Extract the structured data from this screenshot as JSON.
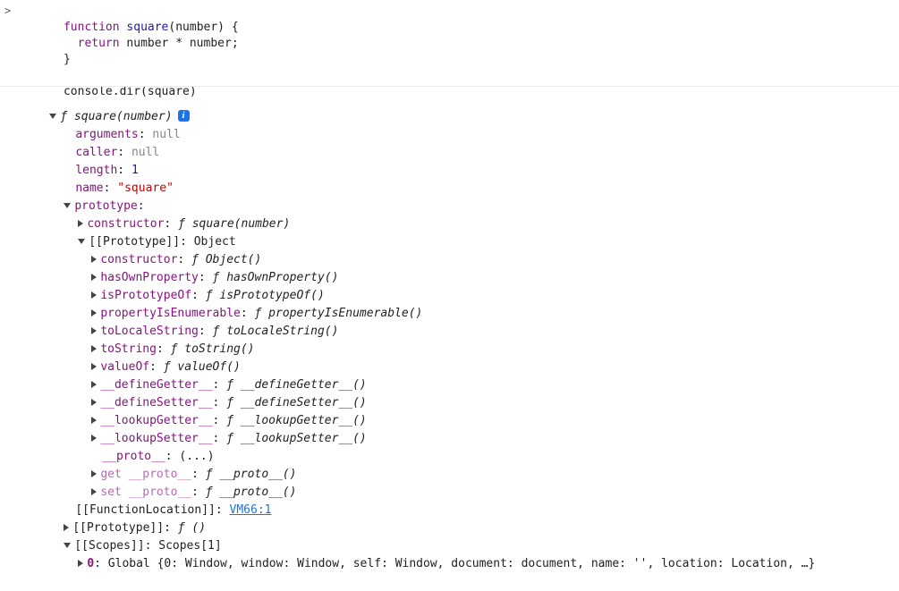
{
  "input": {
    "prompt_symbol": ">",
    "code_lines": [
      {
        "kw": "function",
        "name": " square",
        "rest": "(number) {"
      },
      {
        "kw": "  return",
        "name": "",
        "rest": " number * number;"
      },
      {
        "kw": "",
        "name": "",
        "rest": "}"
      },
      {
        "kw": "",
        "name": "",
        "rest": ""
      },
      {
        "kw": "",
        "name": "",
        "rest": "console.dir(square)"
      }
    ]
  },
  "output": {
    "root": {
      "prefix": "ƒ",
      "text": "square(number)",
      "info_icon": "i"
    },
    "rows": [
      {
        "key": "arguments",
        "value": "null",
        "vtype": "null"
      },
      {
        "key": "caller",
        "value": "null",
        "vtype": "null"
      },
      {
        "key": "length",
        "value": "1",
        "vtype": "num"
      },
      {
        "key": "name",
        "value": "\"square\"",
        "vtype": "str"
      },
      {
        "key": "prototype",
        "value": ""
      },
      {
        "key": "constructor",
        "value": "ƒ square(number)",
        "vtype": "fn"
      },
      {
        "key": "[[Prototype]]",
        "value": "Object",
        "vtype": "obj"
      },
      {
        "key": "constructor",
        "value": "ƒ Object()",
        "vtype": "fn"
      },
      {
        "key": "hasOwnProperty",
        "value": "ƒ hasOwnProperty()",
        "vtype": "fn"
      },
      {
        "key": "isPrototypeOf",
        "value": "ƒ isPrototypeOf()",
        "vtype": "fn"
      },
      {
        "key": "propertyIsEnumerable",
        "value": "ƒ propertyIsEnumerable()",
        "vtype": "fn"
      },
      {
        "key": "toLocaleString",
        "value": "ƒ toLocaleString()",
        "vtype": "fn"
      },
      {
        "key": "toString",
        "value": "ƒ toString()",
        "vtype": "fn"
      },
      {
        "key": "valueOf",
        "value": "ƒ valueOf()",
        "vtype": "fn"
      },
      {
        "key": "__defineGetter__",
        "value": "ƒ __defineGetter__()",
        "vtype": "fn"
      },
      {
        "key": "__defineSetter__",
        "value": "ƒ __defineSetter__()",
        "vtype": "fn"
      },
      {
        "key": "__lookupGetter__",
        "value": "ƒ __lookupGetter__()",
        "vtype": "fn"
      },
      {
        "key": "__lookupSetter__",
        "value": "ƒ __lookupSetter__()",
        "vtype": "fn"
      },
      {
        "key": "__proto__",
        "value": "(...)",
        "vtype": "obj"
      },
      {
        "key": "get __proto__",
        "value": "ƒ __proto__()",
        "vtype": "fn"
      },
      {
        "key": "set __proto__",
        "value": "ƒ __proto__()",
        "vtype": "fn"
      },
      {
        "key": "[[FunctionLocation]]",
        "value": "VM66:1",
        "vtype": "link"
      },
      {
        "key": "[[Prototype]]",
        "value": "ƒ ()",
        "vtype": "fn"
      },
      {
        "key": "[[Scopes]]",
        "value": "Scopes[1]",
        "vtype": "obj"
      },
      {
        "key": "0",
        "value": "Global {0: Window, window: Window, self: Window, document: document, name: '', location: Location, …}",
        "vtype": "obj"
      }
    ]
  },
  "colors": {
    "key": "#881280",
    "key_dim": "#b86ab3",
    "null": "#80868b",
    "number": "#1a1aa6",
    "string": "#c80000",
    "link": "#1a73e8",
    "separator": "#e8eaed"
  },
  "icons": {
    "prompt": "chevron-right-icon",
    "expand": "triangle-right-icon",
    "collapse": "triangle-down-icon",
    "info": "info-icon"
  }
}
